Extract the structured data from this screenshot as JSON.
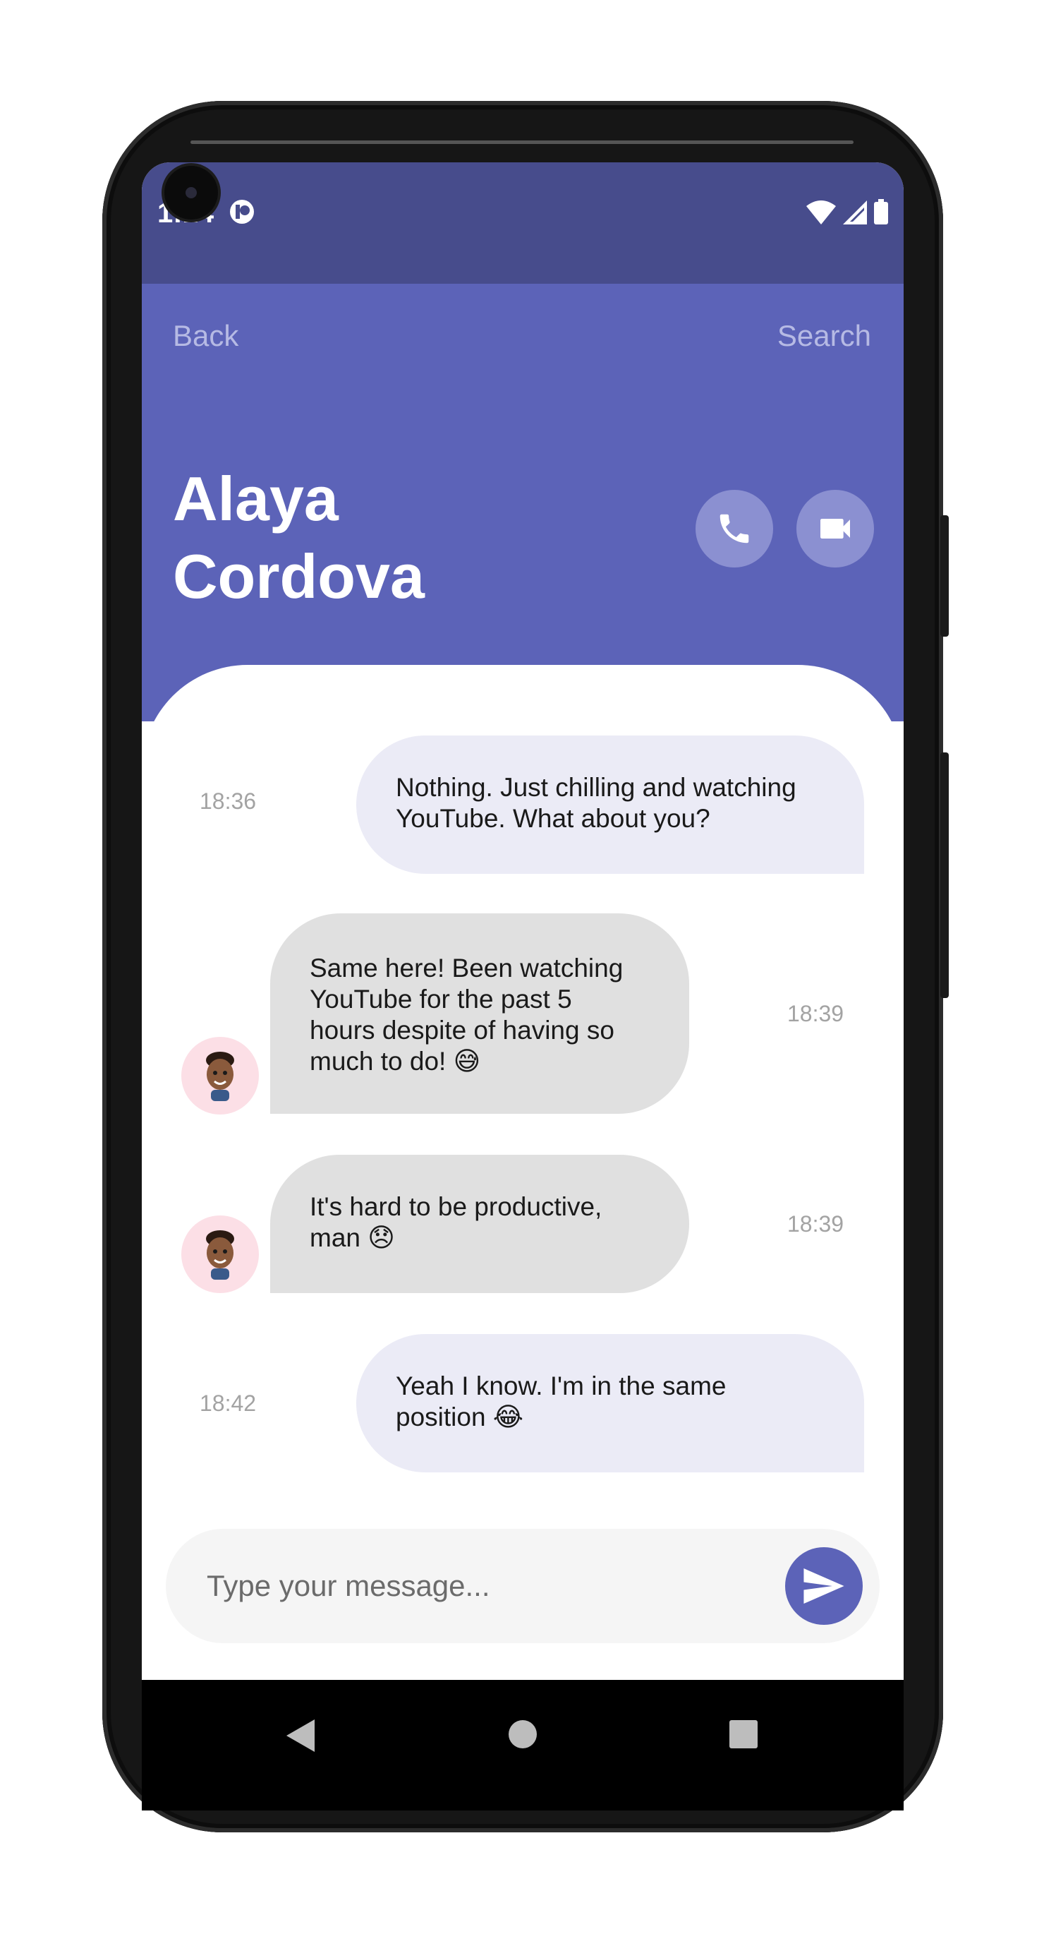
{
  "status_bar": {
    "time": "1:14"
  },
  "header": {
    "back_label": "Back",
    "search_label": "Search",
    "contact_first_name": "Alaya",
    "contact_last_name": "Cordova"
  },
  "messages": [
    {
      "direction": "outgoing",
      "lines": [
        "Nothing. Just chilling and watching",
        "YouTube. What about you?"
      ],
      "time": "18:36"
    },
    {
      "direction": "incoming",
      "lines": [
        "Same here! Been watching",
        "YouTube for the past 5",
        "hours despite of having so",
        "much to do! 😅"
      ],
      "time": "18:39"
    },
    {
      "direction": "incoming",
      "lines": [
        "It's hard to be productive,",
        "man 😞"
      ],
      "time": "18:39"
    },
    {
      "direction": "outgoing",
      "lines": [
        "Yeah I know. I'm in the same",
        "position 😂"
      ],
      "time": "18:42"
    }
  ],
  "composer": {
    "placeholder": "Type your message..."
  },
  "icons": {
    "call": "phone-icon",
    "video": "video-camera-icon",
    "send": "send-icon",
    "avatar": "memoji-avatar-icon",
    "nav_back": "triangle-back-icon",
    "nav_home": "circle-home-icon",
    "nav_recents": "square-recents-icon"
  },
  "colors": {
    "status_bar": "#474c8c",
    "header": "#5c63b8",
    "outgoing_bubble": "#ebebf6",
    "incoming_bubble": "#e0e0e0",
    "avatar_bg": "#fcdfe6"
  }
}
